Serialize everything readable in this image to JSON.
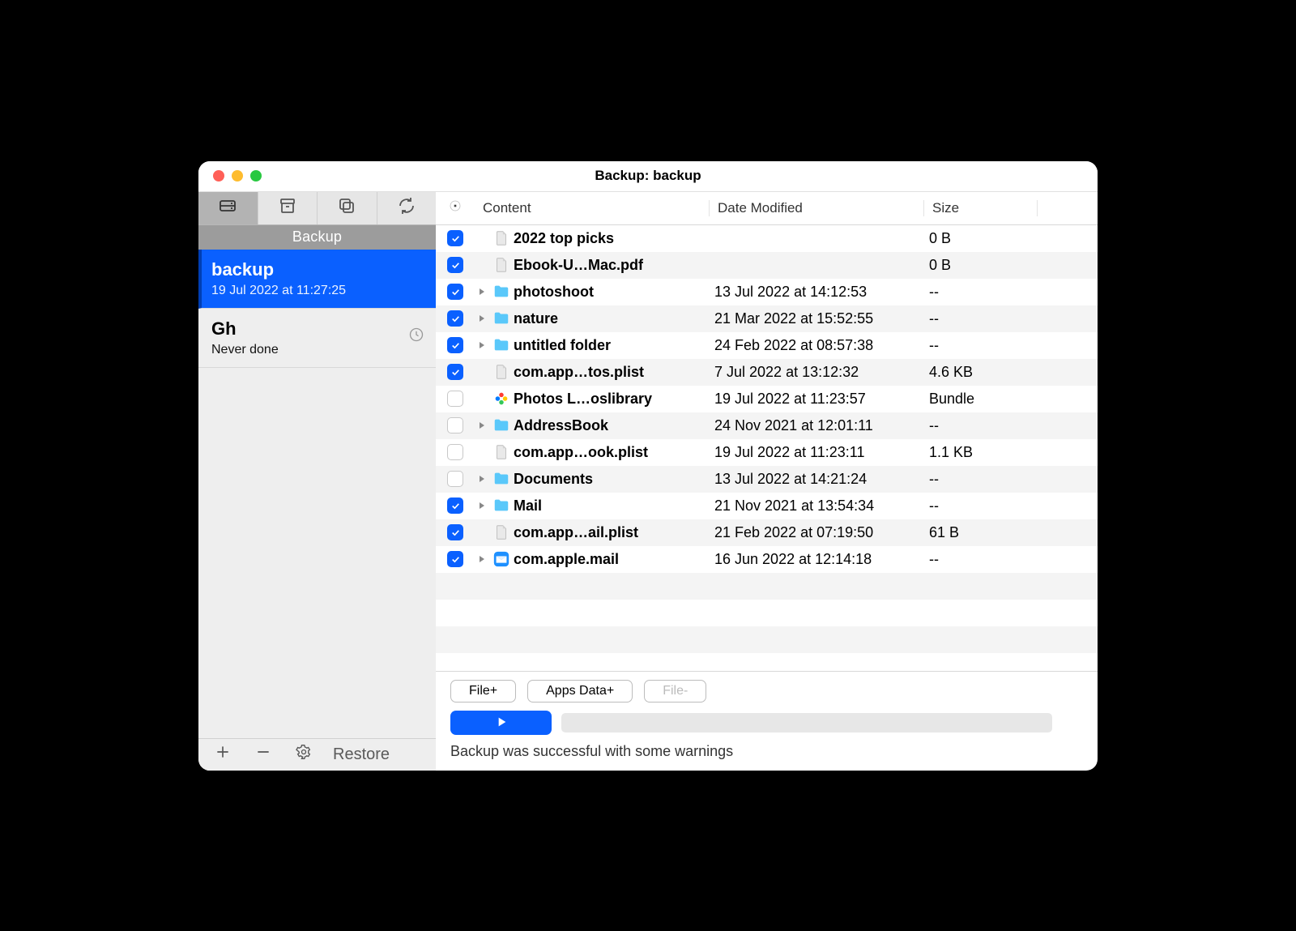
{
  "window": {
    "title": "Backup: backup"
  },
  "sidebar": {
    "section": "Backup",
    "items": [
      {
        "name": "backup",
        "sub": "19 Jul 2022 at 11:27:25",
        "selected": true,
        "clock": false
      },
      {
        "name": "Gh",
        "sub": "Never done",
        "selected": false,
        "clock": true
      }
    ],
    "restore": "Restore"
  },
  "columns": {
    "content": "Content",
    "date": "Date Modified",
    "size": "Size"
  },
  "rows": [
    {
      "checked": true,
      "chevron": false,
      "icon": "file",
      "name": "2022 top picks",
      "date": "",
      "size": "0 B"
    },
    {
      "checked": true,
      "chevron": false,
      "icon": "file",
      "name": "Ebook-U…Mac.pdf",
      "date": "",
      "size": "0 B"
    },
    {
      "checked": true,
      "chevron": true,
      "icon": "folder",
      "name": "photoshoot",
      "date": "13 Jul 2022 at 14:12:53",
      "size": "--"
    },
    {
      "checked": true,
      "chevron": true,
      "icon": "folder",
      "name": "nature",
      "date": "21 Mar 2022 at 15:52:55",
      "size": "--"
    },
    {
      "checked": true,
      "chevron": true,
      "icon": "folder",
      "name": "untitled folder",
      "date": "24 Feb 2022 at 08:57:38",
      "size": "--"
    },
    {
      "checked": true,
      "chevron": false,
      "icon": "file",
      "name": "com.app…tos.plist",
      "date": "7 Jul 2022 at 13:12:32",
      "size": "4.6 KB"
    },
    {
      "checked": false,
      "chevron": false,
      "icon": "photos",
      "name": "Photos L…oslibrary",
      "date": "19 Jul 2022 at 11:23:57",
      "size": "Bundle"
    },
    {
      "checked": false,
      "chevron": true,
      "icon": "folder",
      "name": "AddressBook",
      "date": "24 Nov 2021 at 12:01:11",
      "size": "--"
    },
    {
      "checked": false,
      "chevron": false,
      "icon": "file",
      "name": "com.app…ook.plist",
      "date": "19 Jul 2022 at 11:23:11",
      "size": "1.1 KB"
    },
    {
      "checked": false,
      "chevron": true,
      "icon": "folder",
      "name": "Documents",
      "date": "13 Jul 2022 at 14:21:24",
      "size": "--"
    },
    {
      "checked": true,
      "chevron": true,
      "icon": "folder",
      "name": "Mail",
      "date": "21 Nov 2021 at 13:54:34",
      "size": "--"
    },
    {
      "checked": true,
      "chevron": false,
      "icon": "file",
      "name": "com.app…ail.plist",
      "date": "21 Feb 2022 at 07:19:50",
      "size": "61 B"
    },
    {
      "checked": true,
      "chevron": true,
      "icon": "mailapp",
      "name": "com.apple.mail",
      "date": "16 Jun 2022 at 12:14:18",
      "size": "--"
    }
  ],
  "footer": {
    "file_plus": "File+",
    "apps_data_plus": "Apps Data+",
    "file_minus": "File-",
    "status": "Backup was successful with some warnings"
  }
}
